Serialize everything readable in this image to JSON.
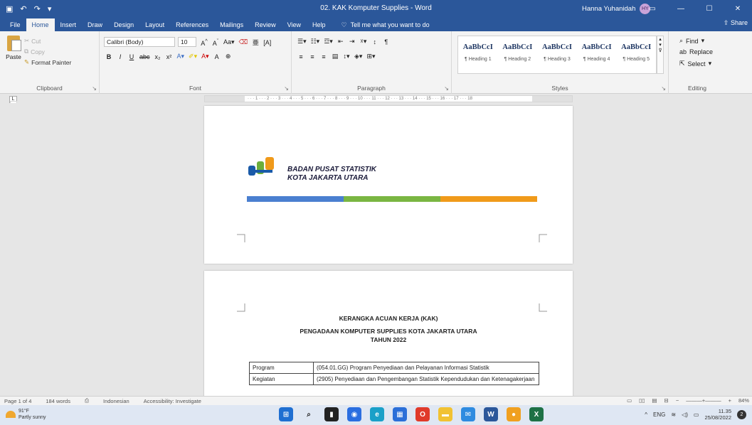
{
  "titlebar": {
    "title": "02. KAK Komputer Supplies - Word",
    "user": "Hanna Yuhanidah",
    "user_initials": "HY"
  },
  "tabs": [
    "File",
    "Home",
    "Insert",
    "Draw",
    "Design",
    "Layout",
    "References",
    "Mailings",
    "Review",
    "View",
    "Help"
  ],
  "tellme": "Tell me what you want to do",
  "share": "Share",
  "ribbon": {
    "clipboard": {
      "paste": "Paste",
      "cut": "Cut",
      "copy": "Copy",
      "format_painter": "Format Painter",
      "label": "Clipboard"
    },
    "font": {
      "name": "Calibri (Body)",
      "size": "10",
      "label": "Font"
    },
    "paragraph": {
      "label": "Paragraph"
    },
    "styles": {
      "label": "Styles",
      "items": [
        {
          "sample": "AaBbCcI",
          "name": "¶ Heading 1"
        },
        {
          "sample": "AaBbCcI",
          "name": "¶ Heading 2"
        },
        {
          "sample": "AaBbCcI",
          "name": "¶ Heading 3"
        },
        {
          "sample": "AaBbCcI",
          "name": "¶ Heading 4"
        },
        {
          "sample": "AaBbCcI",
          "name": "¶ Heading 5"
        }
      ]
    },
    "editing": {
      "find": "Find",
      "replace": "Replace",
      "select": "Select",
      "label": "Editing"
    }
  },
  "document": {
    "org_line1": "BADAN PUSAT STATISTIK",
    "org_line2": "KOTA JAKARTA UTARA",
    "bar_colors": [
      "#4a7fd0",
      "#7ab642",
      "#f09a1a"
    ],
    "kak_title": "KERANGKA ACUAN KERJA (KAK)",
    "kak_subtitle": "PENGADAAN KOMPUTER SUPPLIES KOTA JAKARTA UTARA",
    "kak_year": "TAHUN 2022",
    "table": [
      {
        "label": "Program",
        "value": "(054.01.GG) Program Penyediaan dan Pelayanan Informasi Statistik"
      },
      {
        "label": "Kegiatan",
        "value": "(2905) Penyediaan dan Pengembangan Statistik Kependudukan dan Ketenagakerjaan"
      }
    ]
  },
  "statusbar": {
    "page": "Page 1 of 4",
    "words": "184 words",
    "language": "Indonesian",
    "accessibility": "Accessibility: Investigate",
    "zoom": "84%"
  },
  "taskbar": {
    "temp": "91°F",
    "weather": "Partly sunny",
    "lang": "ENG",
    "time": "11.35",
    "date": "25/08/2022",
    "notifications": "2"
  }
}
